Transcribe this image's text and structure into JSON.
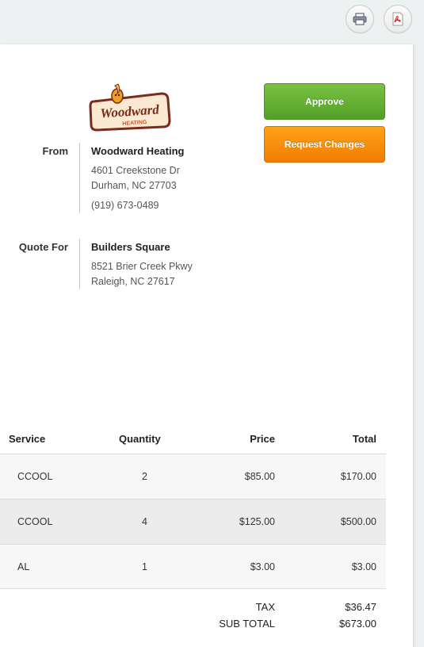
{
  "toolbar": {
    "print_icon": "printer-icon",
    "pdf_icon": "pdf-icon"
  },
  "logo": {
    "line1": "Woodward",
    "line2": "HEATING"
  },
  "actions": {
    "approve": "Approve",
    "request_changes": "Request Changes"
  },
  "from": {
    "label": "From",
    "name": "Woodward Heating",
    "address1": "4601 Creekstone Dr",
    "address2": "Durham, NC 27703",
    "phone": "(919) 673-0489"
  },
  "quote_for": {
    "label": "Quote For",
    "name": "Builders Square",
    "address1": "8521 Brier Creek Pkwy",
    "address2": "Raleigh, NC 27617"
  },
  "table": {
    "headers": {
      "service": "Service",
      "quantity": "Quantity",
      "price": "Price",
      "total": "Total"
    },
    "rows": [
      {
        "service": "CCOOL",
        "quantity": "2",
        "price": "$85.00",
        "total": "$170.00"
      },
      {
        "service": "CCOOL",
        "quantity": "4",
        "price": "$125.00",
        "total": "$500.00"
      },
      {
        "service": "AL",
        "quantity": "1",
        "price": "$3.00",
        "total": "$3.00"
      }
    ]
  },
  "totals": {
    "tax_label": "TAX",
    "tax_value": "$36.47",
    "subtotal_label": "SUB TOTAL",
    "subtotal_value": "$673.00"
  },
  "colors": {
    "approve": "#65b133",
    "request_changes": "#f88c0a"
  }
}
